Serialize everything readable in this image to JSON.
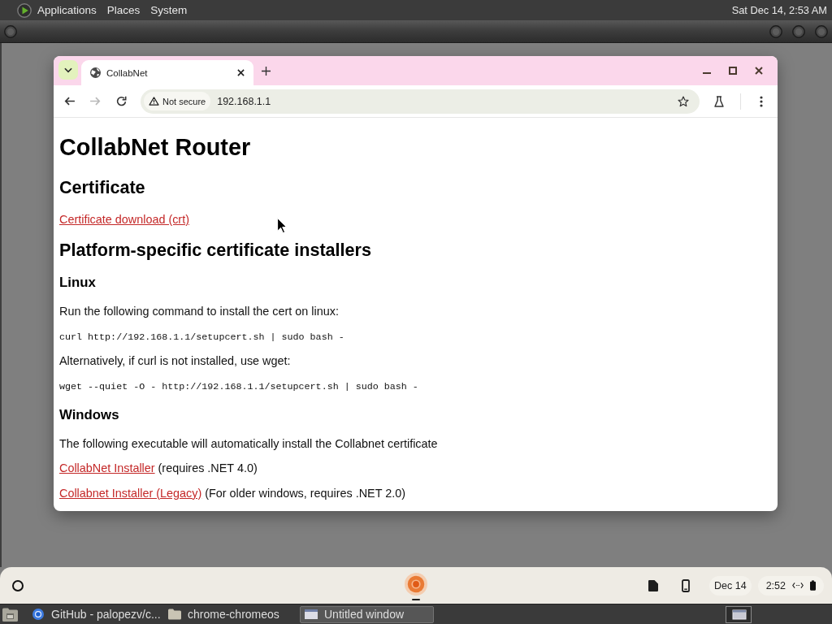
{
  "top_panel": {
    "menus": [
      {
        "label": "Applications"
      },
      {
        "label": "Places"
      },
      {
        "label": "System"
      }
    ],
    "clock": "Sat Dec 14, 2:53 AM"
  },
  "browser": {
    "tabs": [
      {
        "title": "CollabNet",
        "selected": true
      }
    ],
    "nav_buttons": [
      {
        "kind": "back",
        "disabled": false
      },
      {
        "kind": "forward",
        "disabled": true
      },
      {
        "kind": "reload",
        "disabled": false
      }
    ],
    "address_bar": {
      "security_chip": "Not secure",
      "url": "192.168.1.1"
    },
    "page": [
      {
        "kind": "h1",
        "text": "CollabNet Router"
      },
      {
        "kind": "h2",
        "text": "Certificate"
      },
      {
        "kind": "p",
        "parts": [
          {
            "kind": "link",
            "text": "Certificate download (crt)"
          }
        ]
      },
      {
        "kind": "h2",
        "text": "Platform-specific certificate installers"
      },
      {
        "kind": "h3",
        "text": "Linux"
      },
      {
        "kind": "p",
        "parts": [
          {
            "kind": "text",
            "text": "Run the following command to install the cert on linux:"
          }
        ]
      },
      {
        "kind": "code",
        "text": "curl http://192.168.1.1/setupcert.sh | sudo bash -"
      },
      {
        "kind": "p",
        "parts": [
          {
            "kind": "text",
            "text": "Alternatively, if curl is not installed, use wget:"
          }
        ]
      },
      {
        "kind": "code",
        "text": "wget --quiet -O - http://192.168.1.1/setupcert.sh | sudo bash -"
      },
      {
        "kind": "h3",
        "text": "Windows"
      },
      {
        "kind": "p",
        "parts": [
          {
            "kind": "text",
            "text": "The following executable will automatically install the Collabnet certificate"
          }
        ]
      },
      {
        "kind": "p",
        "parts": [
          {
            "kind": "link",
            "text": "CollabNet Installer"
          },
          {
            "kind": "text",
            "text": "(requires .NET 4.0)"
          }
        ]
      },
      {
        "kind": "p",
        "parts": [
          {
            "kind": "link",
            "text": "Collabnet Installer (Legacy)"
          },
          {
            "kind": "text",
            "text": "(For older windows, requires .NET 2.0)"
          }
        ]
      }
    ]
  },
  "shelf": {
    "apps": [
      {
        "kind": "browser",
        "running": true
      }
    ],
    "date": "Dec 14",
    "time": "2:52"
  },
  "taskbar": {
    "items": [
      {
        "kind": "browser",
        "label": "GitHub - palopezv/c...",
        "selected": false
      },
      {
        "kind": "folder",
        "label": "chrome-chromeos",
        "selected": false
      },
      {
        "kind": "window",
        "label": "Untitled window",
        "selected": true
      }
    ]
  }
}
